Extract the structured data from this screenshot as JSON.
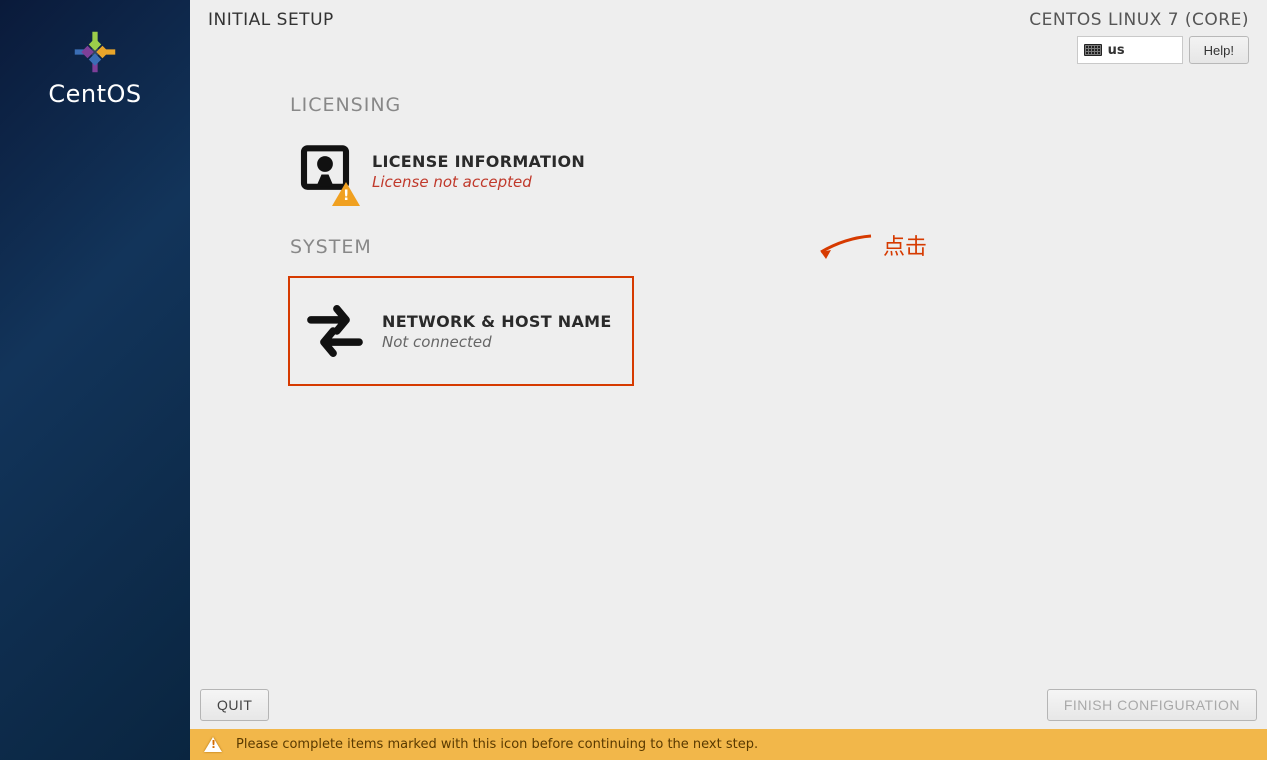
{
  "sidebar": {
    "product_name": "CentOS"
  },
  "header": {
    "title": "INITIAL SETUP",
    "distro": "CENTOS LINUX 7 (CORE)",
    "keyboard_layout": "us",
    "help_label": "Help!"
  },
  "sections": {
    "licensing": {
      "label": "LICENSING",
      "spoke": {
        "title": "LICENSE INFORMATION",
        "status": "License not accepted",
        "status_warn": true
      }
    },
    "system": {
      "label": "SYSTEM",
      "spoke": {
        "title": "NETWORK & HOST NAME",
        "status": "Not connected",
        "status_warn": false
      }
    }
  },
  "annotation": {
    "text": "点击"
  },
  "footer": {
    "quit_label": "QUIT",
    "finish_label": "FINISH CONFIGURATION"
  },
  "warning_bar": {
    "message": "Please complete items marked with this icon before continuing to the next step."
  }
}
